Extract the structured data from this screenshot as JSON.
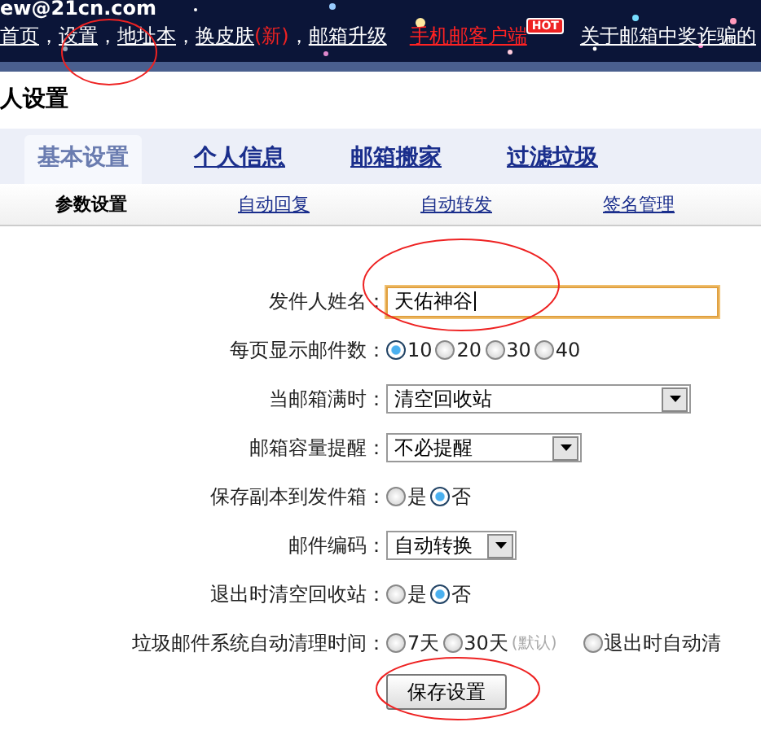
{
  "header": {
    "account": "ew@21cn.com",
    "nav": [
      {
        "label": "首页",
        "kind": "link",
        "sep": "，"
      },
      {
        "label": "设置",
        "kind": "link",
        "sep": "，"
      },
      {
        "label": "地址本",
        "kind": "link",
        "sep": "，"
      },
      {
        "label": "换皮肤",
        "kind": "link",
        "badge": "(新)",
        "sep": "，"
      },
      {
        "label": "邮箱升级",
        "kind": "link"
      },
      {
        "label": "手机邮客户端",
        "kind": "promo",
        "badge": "HOT"
      },
      {
        "label": "关于邮箱中奖诈骗的",
        "kind": "link"
      }
    ]
  },
  "page_title": "人设置",
  "tabs": [
    {
      "label": "基本设置",
      "selected": true
    },
    {
      "label": "个人信息",
      "selected": false
    },
    {
      "label": "邮箱搬家",
      "selected": false
    },
    {
      "label": "过滤垃圾",
      "selected": false
    }
  ],
  "subtabs": [
    {
      "label": "参数设置",
      "selected": true
    },
    {
      "label": "自动回复",
      "selected": false
    },
    {
      "label": "自动转发",
      "selected": false
    },
    {
      "label": "签名管理",
      "selected": false
    }
  ],
  "form": [
    {
      "kind": "text",
      "label": "发件人姓名：",
      "value": "天佑神谷",
      "focused": true
    },
    {
      "kind": "radio",
      "label": "每页显示邮件数：",
      "options": [
        {
          "label": "10",
          "selected": true
        },
        {
          "label": "20",
          "selected": false
        },
        {
          "label": "30",
          "selected": false
        },
        {
          "label": "40",
          "selected": false
        }
      ]
    },
    {
      "kind": "select",
      "label": "当邮箱满时：",
      "value": "清空回收站"
    },
    {
      "kind": "select",
      "label": "邮箱容量提醒：",
      "value": "不必提醒"
    },
    {
      "kind": "radio",
      "label": "保存副本到发件箱：",
      "options": [
        {
          "label": "是",
          "selected": false
        },
        {
          "label": "否",
          "selected": true
        }
      ]
    },
    {
      "kind": "select",
      "label": "邮件编码：",
      "value": "自动转换"
    },
    {
      "kind": "radio",
      "label": "退出时清空回收站：",
      "options": [
        {
          "label": "是",
          "selected": false
        },
        {
          "label": "否",
          "selected": true
        }
      ]
    },
    {
      "kind": "radio",
      "label": "垃圾邮件系统自动清理时间：",
      "options": [
        {
          "label": "7天",
          "selected": false
        },
        {
          "label": "30天",
          "note": "(默认)",
          "selected": false
        },
        {
          "label": "退出时自动清",
          "selected": false
        }
      ]
    }
  ],
  "save_button": "保存设置"
}
